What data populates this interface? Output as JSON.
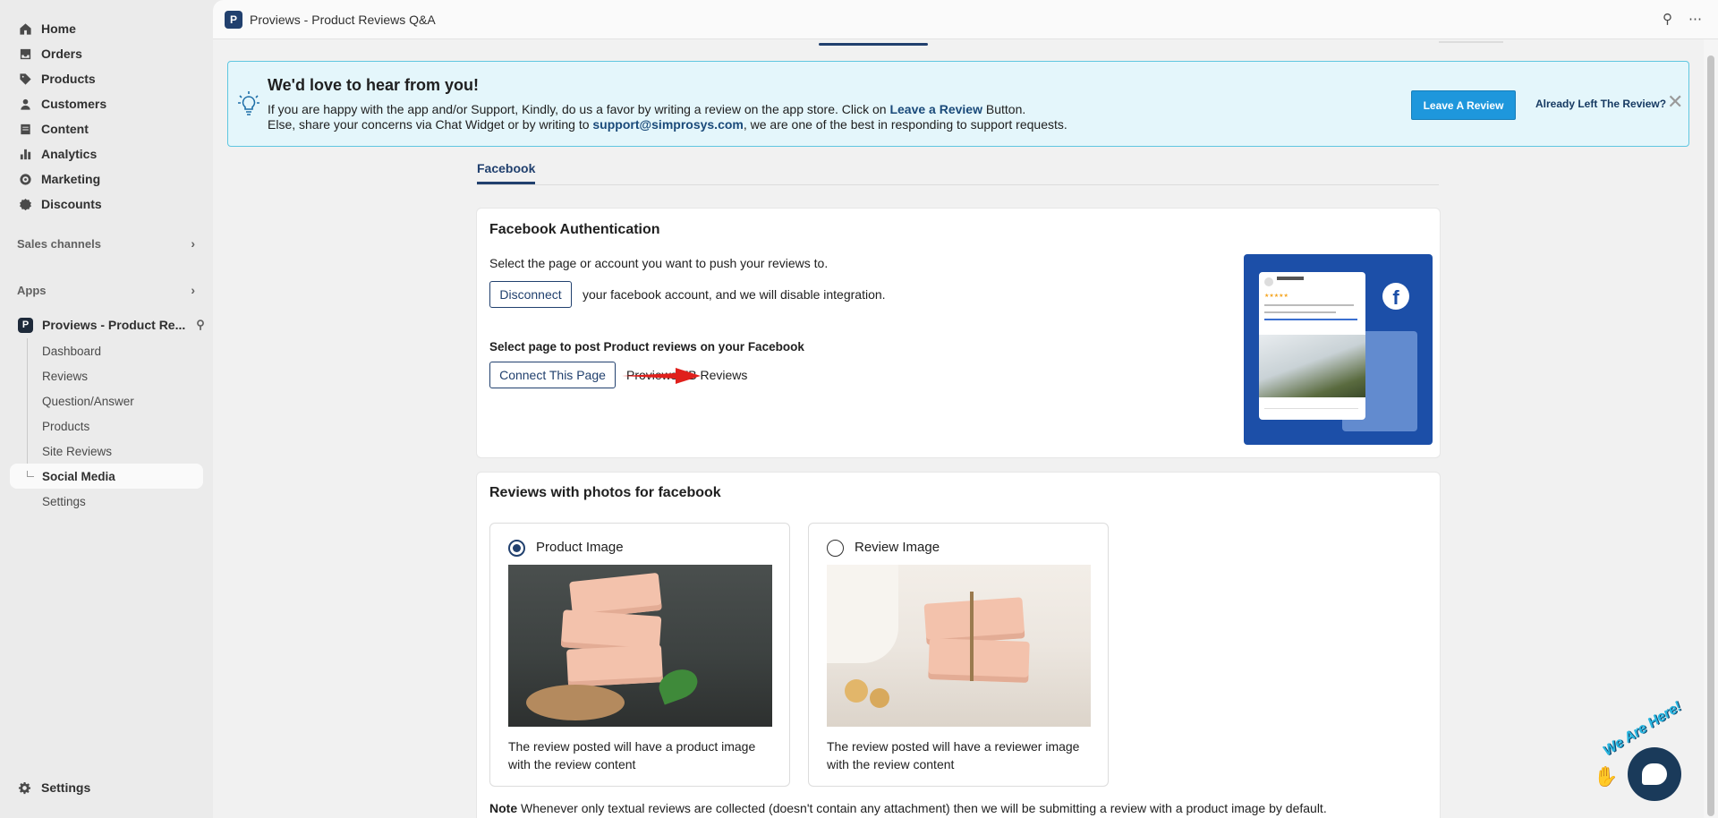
{
  "sidebar": {
    "items": [
      {
        "label": "Home",
        "icon": "home-icon"
      },
      {
        "label": "Orders",
        "icon": "inbox-icon"
      },
      {
        "label": "Products",
        "icon": "tag-icon"
      },
      {
        "label": "Customers",
        "icon": "person-icon"
      },
      {
        "label": "Content",
        "icon": "document-icon"
      },
      {
        "label": "Analytics",
        "icon": "bar-chart-icon"
      },
      {
        "label": "Marketing",
        "icon": "target-icon"
      },
      {
        "label": "Discounts",
        "icon": "discount-icon"
      }
    ],
    "sales_channels": "Sales channels",
    "apps": "Apps",
    "app_name": "Proviews - Product Re...",
    "app_sub_items": [
      "Dashboard",
      "Reviews",
      "Question/Answer",
      "Products",
      "Site Reviews",
      "Social Media",
      "Settings"
    ],
    "active_sub_item": "Social Media",
    "settings": "Settings"
  },
  "appbar": {
    "title": "Proviews - Product Reviews Q&A"
  },
  "banner": {
    "heading": "We'd love to hear from you!",
    "line1_a": "If you are happy with the app and/or Support, Kindly, do us a favor by writing a review on the app store. Click on ",
    "line1_link": "Leave a Review",
    "line1_b": " Button.",
    "line2_a": "Else, share your concerns via Chat Widget or by writing to ",
    "line2_link": "support@simprosys.com",
    "line2_b": ", we are one of the best in responding to support requests.",
    "leave_button": "Leave A Review",
    "already_link": "Already Left The Review?",
    "accent_color": "#1e97dc",
    "background_color": "#e4f6fb"
  },
  "tabs": [
    {
      "label": "Facebook",
      "active": true
    }
  ],
  "fb_auth": {
    "title": "Facebook Authentication",
    "select_text": "Select the page or account you want to push your reviews to.",
    "disconnect_button": "Disconnect",
    "disconnect_text": "your facebook account, and we will disable integration.",
    "select_page_label": "Select page to post Product reviews on your Facebook",
    "connect_button": "Connect This Page",
    "page_name": "Proviews FB Reviews"
  },
  "photos": {
    "title": "Reviews with photos for facebook",
    "options": [
      {
        "label": "Product Image",
        "selected": true,
        "desc": "The review posted will have a product image with the review content"
      },
      {
        "label": "Review Image",
        "selected": false,
        "desc": "The review posted will have a reviewer image with the review content"
      }
    ],
    "note_label": "Note",
    "note_text": " Whenever only textual reviews are collected (doesn't contain any attachment) then we will be submitting a review with a product image by default."
  },
  "chat": {
    "tag": "We Are Here!"
  },
  "colors": {
    "brand": "#21406e",
    "arrow": "#e0201c"
  }
}
